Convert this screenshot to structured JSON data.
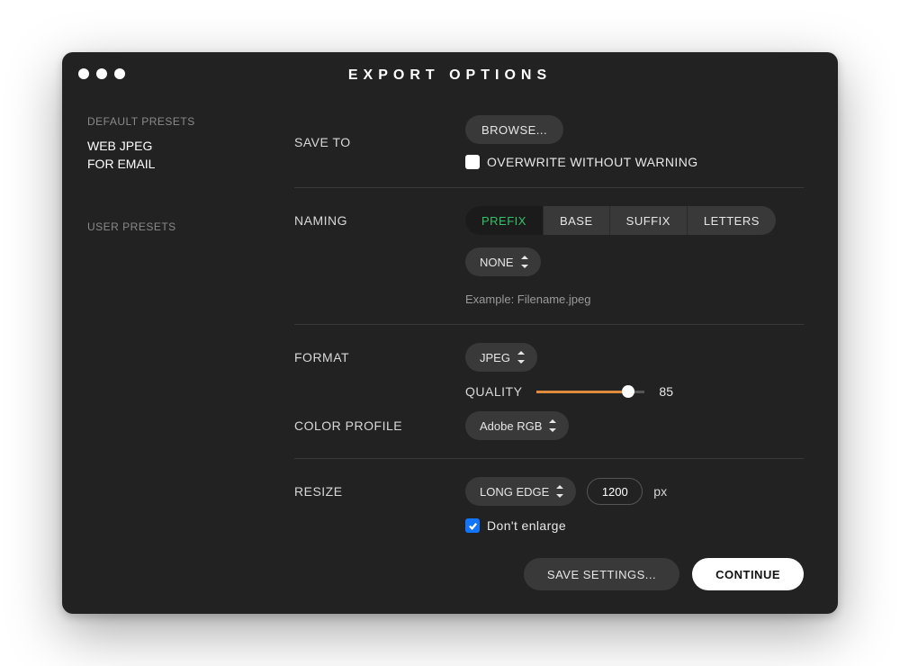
{
  "window": {
    "title": "EXPORT OPTIONS"
  },
  "sidebar": {
    "default_header": "DEFAULT PRESETS",
    "default_items": [
      "WEB JPEG",
      "FOR EMAIL"
    ],
    "user_header": "USER PRESETS",
    "user_items": []
  },
  "saveTo": {
    "label": "SAVE TO",
    "browse": "BROWSE...",
    "overwrite_label": "OVERWRITE WITHOUT WARNING",
    "overwrite_checked": false
  },
  "naming": {
    "label": "NAMING",
    "tabs": [
      "PREFIX",
      "BASE",
      "SUFFIX",
      "LETTERS"
    ],
    "active_tab": "PREFIX",
    "dropdown": "NONE",
    "example": "Example: Filename.jpeg"
  },
  "format": {
    "label": "FORMAT",
    "value": "JPEG",
    "quality_label": "QUALITY",
    "quality_value": 85,
    "color_profile_label": "COLOR PROFILE",
    "color_profile_value": "Adobe RGB"
  },
  "resize": {
    "label": "RESIZE",
    "mode": "LONG EDGE",
    "value": "1200",
    "unit": "px",
    "dont_enlarge_label": "Don't enlarge",
    "dont_enlarge_checked": true
  },
  "footer": {
    "save_settings": "SAVE SETTINGS...",
    "continue": "CONTINUE"
  }
}
